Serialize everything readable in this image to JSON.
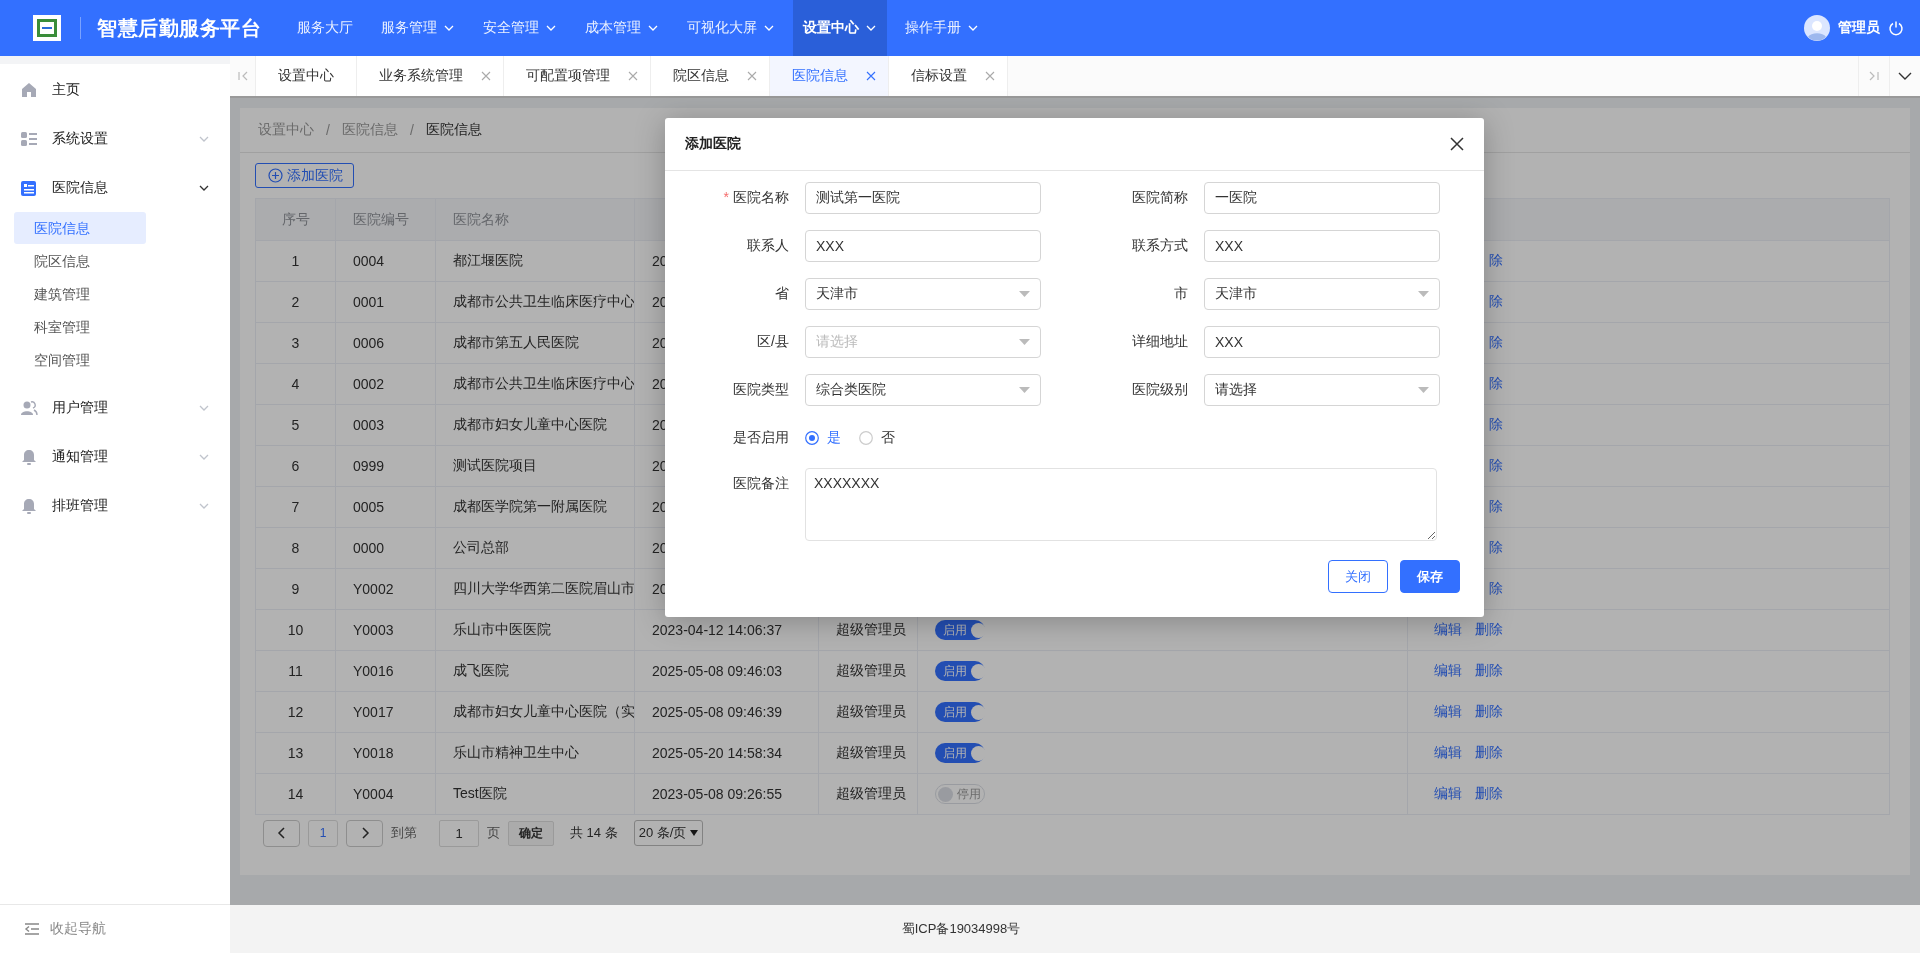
{
  "header": {
    "title": "智慧后勤服务平台",
    "nav": [
      {
        "label": "服务大厅",
        "dropdown": false,
        "selected": false
      },
      {
        "label": "服务管理",
        "dropdown": true,
        "selected": false
      },
      {
        "label": "安全管理",
        "dropdown": true,
        "selected": false
      },
      {
        "label": "成本管理",
        "dropdown": true,
        "selected": false
      },
      {
        "label": "可视化大屏",
        "dropdown": true,
        "selected": false
      },
      {
        "label": "设置中心",
        "dropdown": true,
        "selected": true
      },
      {
        "label": "操作手册",
        "dropdown": true,
        "selected": false
      }
    ],
    "user": "管理员"
  },
  "sidebar": {
    "items": [
      {
        "label": "主页",
        "kind": "link"
      },
      {
        "label": "系统设置",
        "kind": "group",
        "expanded": false
      },
      {
        "label": "医院信息",
        "kind": "group",
        "expanded": true,
        "children": [
          {
            "label": "医院信息",
            "selected": true
          },
          {
            "label": "院区信息",
            "selected": false
          },
          {
            "label": "建筑管理",
            "selected": false
          },
          {
            "label": "科室管理",
            "selected": false
          },
          {
            "label": "空间管理",
            "selected": false
          }
        ]
      },
      {
        "label": "用户管理",
        "kind": "group",
        "expanded": false
      },
      {
        "label": "通知管理",
        "kind": "group",
        "expanded": false
      },
      {
        "label": "排班管理",
        "kind": "group",
        "expanded": false
      }
    ],
    "collapse": "收起导航"
  },
  "tabs": [
    {
      "label": "设置中心",
      "closable": false,
      "selected": false
    },
    {
      "label": "业务系统管理",
      "closable": true,
      "selected": false
    },
    {
      "label": "可配置项管理",
      "closable": true,
      "selected": false
    },
    {
      "label": "院区信息",
      "closable": true,
      "selected": false
    },
    {
      "label": "医院信息",
      "closable": true,
      "selected": true
    },
    {
      "label": "信标设置",
      "closable": true,
      "selected": false
    }
  ],
  "breadcrumb": {
    "items": [
      "设置中心",
      "医院信息",
      "医院信息"
    ],
    "separator": "/"
  },
  "add_button": "添加医院",
  "table": {
    "columns": [
      "序号",
      "医院编号",
      "医院名称"
    ],
    "rows": [
      {
        "no": "1",
        "code": "0004",
        "name": "都江堰医院",
        "created": "20",
        "actions": [
          {
            "kind": "delete",
            "label": "除"
          }
        ]
      },
      {
        "no": "2",
        "code": "0001",
        "name": "成都市公共卫生临床医疗中心",
        "created": "20",
        "actions": [
          {
            "kind": "delete",
            "label": "除"
          }
        ]
      },
      {
        "no": "3",
        "code": "0006",
        "name": "成都市第五人民医院",
        "created": "20",
        "actions": [
          {
            "kind": "delete",
            "label": "除"
          }
        ]
      },
      {
        "no": "4",
        "code": "0002",
        "name": "成都市公共卫生临床医疗中心",
        "created": "20",
        "actions": [
          {
            "kind": "delete",
            "label": "除"
          }
        ]
      },
      {
        "no": "5",
        "code": "0003",
        "name": "成都市妇女儿童中心医院",
        "created": "20",
        "actions": [
          {
            "kind": "delete",
            "label": "除"
          }
        ]
      },
      {
        "no": "6",
        "code": "0999",
        "name": "测试医院项目",
        "created": "20",
        "actions": [
          {
            "kind": "delete",
            "label": "除"
          }
        ]
      },
      {
        "no": "7",
        "code": "0005",
        "name": "成都医学院第一附属医院",
        "created": "20",
        "actions": [
          {
            "kind": "delete",
            "label": "除"
          }
        ]
      },
      {
        "no": "8",
        "code": "0000",
        "name": "公司总部",
        "created": "20",
        "actions": [
          {
            "kind": "delete",
            "label": "除"
          }
        ]
      },
      {
        "no": "9",
        "code": "Y0002",
        "name": "四川大学华西第二医院眉山市",
        "created": "20",
        "actions": [
          {
            "kind": "delete",
            "label": "除"
          }
        ]
      },
      {
        "no": "10",
        "code": "Y0003",
        "name": "乐山市中医医院",
        "created": "2023-04-12 14:06:37",
        "creator": "超级管理员",
        "status": {
          "on": true,
          "label": "启用"
        },
        "actions": [
          {
            "kind": "edit",
            "label": "编辑"
          },
          {
            "kind": "delete",
            "label": "删除"
          }
        ]
      },
      {
        "no": "11",
        "code": "Y0016",
        "name": "成飞医院",
        "created": "2025-05-08 09:46:03",
        "creator": "超级管理员",
        "status": {
          "on": true,
          "label": "启用"
        },
        "actions": [
          {
            "kind": "edit",
            "label": "编辑"
          },
          {
            "kind": "delete",
            "label": "删除"
          }
        ]
      },
      {
        "no": "12",
        "code": "Y0017",
        "name": "成都市妇女儿童中心医院（实",
        "created": "2025-05-08 09:46:39",
        "creator": "超级管理员",
        "status": {
          "on": true,
          "label": "启用"
        },
        "actions": [
          {
            "kind": "edit",
            "label": "编辑"
          },
          {
            "kind": "delete",
            "label": "删除"
          }
        ]
      },
      {
        "no": "13",
        "code": "Y0018",
        "name": "乐山市精神卫生中心",
        "created": "2025-05-20 14:58:34",
        "creator": "超级管理员",
        "status": {
          "on": true,
          "label": "启用"
        },
        "actions": [
          {
            "kind": "edit",
            "label": "编辑"
          },
          {
            "kind": "delete",
            "label": "删除"
          }
        ]
      },
      {
        "no": "14",
        "code": "Y0004",
        "name": "Test医院",
        "created": "2023-05-08 09:26:55",
        "creator": "超级管理员",
        "status": {
          "on": false,
          "label": "停用"
        },
        "actions": [
          {
            "kind": "edit",
            "label": "编辑"
          },
          {
            "kind": "delete",
            "label": "删除"
          }
        ]
      }
    ]
  },
  "pagination": {
    "pages": [
      {
        "label": "1",
        "selected": true
      }
    ],
    "goto_label": "到第",
    "goto_value": "1",
    "page_unit": "页",
    "confirm": "确定",
    "total": "共 14 条",
    "page_size": "20 条/页"
  },
  "dialog": {
    "title": "添加医院",
    "required_mark": "*",
    "fields": [
      {
        "kind": "text",
        "label": "医院名称",
        "required": true,
        "value": "测试第一医院"
      },
      {
        "kind": "text",
        "label": "医院简称",
        "required": false,
        "value": "一医院"
      },
      {
        "kind": "text",
        "label": "联系人",
        "required": false,
        "value": "XXX"
      },
      {
        "kind": "text",
        "label": "联系方式",
        "required": false,
        "value": "XXX"
      },
      {
        "kind": "select",
        "label": "省",
        "required": false,
        "value": "天津市"
      },
      {
        "kind": "select",
        "label": "市",
        "required": false,
        "value": "天津市"
      },
      {
        "kind": "select",
        "label": "区/县",
        "required": false,
        "placeholder": "请选择"
      },
      {
        "kind": "text",
        "label": "详细地址",
        "required": false,
        "value": "XXX"
      },
      {
        "kind": "select",
        "label": "医院类型",
        "required": false,
        "value": "综合类医院"
      },
      {
        "kind": "select",
        "label": "医院级别",
        "required": false,
        "value": "请选择"
      },
      {
        "kind": "radio",
        "label": "是否启用",
        "required": false,
        "options": [
          {
            "label": "是",
            "selected": true
          },
          {
            "label": "否",
            "selected": false
          }
        ]
      },
      {
        "kind": "textarea",
        "label": "医院备注",
        "required": false,
        "value": "XXXXXXX"
      }
    ],
    "buttons": [
      {
        "kind": "secondary",
        "label": "关闭"
      },
      {
        "kind": "primary",
        "label": "保存"
      }
    ]
  },
  "footer": "蜀ICP备19034998号"
}
